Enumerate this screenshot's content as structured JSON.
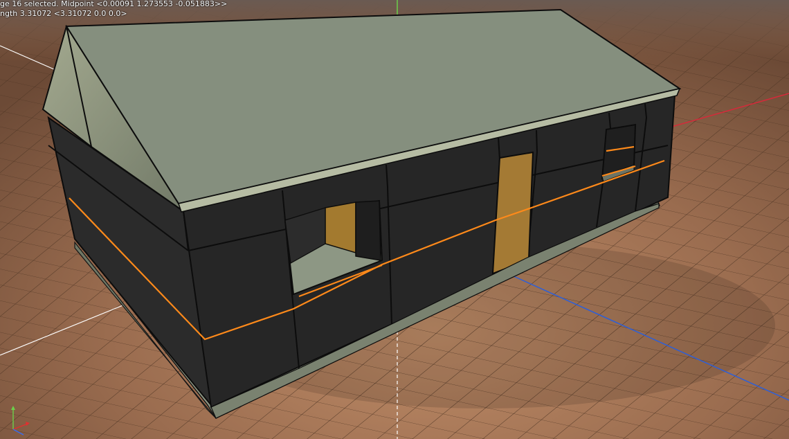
{
  "status": {
    "line1": "ge 16 selected. Midpoint <0.00091  1.273553  -0.051883>>",
    "line2": "ngth 3.31072  <3.31072  0.0  0.0>"
  },
  "gizmo": {
    "y_axis_color": "#6bd04a",
    "x_axis_color": "#e03030",
    "z_axis_color": "#3a6cf0"
  },
  "scene": {
    "selection_color": "#ff8a1a",
    "wall_color": "#242424",
    "roof_color": "#858f7e",
    "floor_color": "#b78a65"
  }
}
